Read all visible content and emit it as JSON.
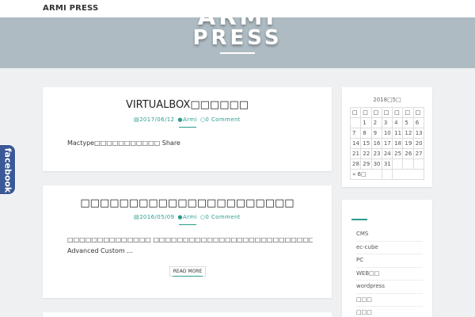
{
  "site": {
    "brand": "ARMI PRESS",
    "hero_line1": "ARMI",
    "hero_line2": "PRESS"
  },
  "posts": [
    {
      "title": "VIRTUALBOX□□□□□□",
      "date": "2017/06/12",
      "author": "Armi",
      "comments": "0 Comment",
      "excerpt": "Mactype□□□□□□□□□□□ Share"
    },
    {
      "title": "□□□□□□□□□□□□□□□□□□□□□□",
      "date": "2016/05/09",
      "author": "Armi",
      "comments": "0 Comment",
      "excerpt_line1": "□□□□□□□□□□□□□□ □□□□□□□□□□□□□□□□□□□□□□□□□□□□□□□□□□□□□□□□□□□□□□□□□□□",
      "excerpt_line2": "Advanced Custom ...",
      "read_more": "READ MORE"
    }
  ],
  "calendar": {
    "caption": "2018□5□",
    "headers": [
      "□",
      "□",
      "□",
      "□",
      "□",
      "□",
      "□"
    ],
    "rows": [
      [
        "",
        "1",
        "2",
        "3",
        "4",
        "5",
        "6"
      ],
      [
        "7",
        "8",
        "9",
        "10",
        "11",
        "12",
        "13"
      ],
      [
        "14",
        "15",
        "16",
        "17",
        "18",
        "19",
        "20"
      ],
      [
        "21",
        "22",
        "23",
        "24",
        "25",
        "26",
        "27"
      ],
      [
        "28",
        "29",
        "30",
        "31",
        "",
        "",
        ""
      ]
    ],
    "prev": "« 6□"
  },
  "categories": [
    "CMS",
    "ec-cube",
    "PC",
    "WEB□□",
    "wordpress",
    "□□□",
    "□□□"
  ],
  "facebook_tab": "facebook",
  "colors": {
    "accent": "#2a9d8f",
    "hero_bg": "#aebbc3",
    "page_bg": "#eef0f2",
    "facebook": "#3b5998"
  }
}
